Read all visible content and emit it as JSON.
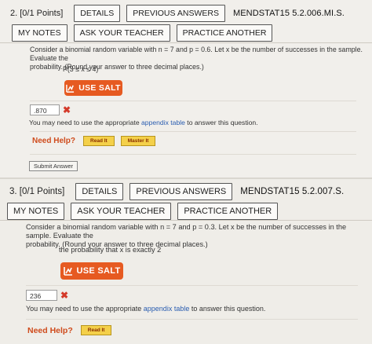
{
  "questions": [
    {
      "number_label": "2. [0/1 Points]",
      "details_label": "DETAILS",
      "previous_answers_label": "PREVIOUS ANSWERS",
      "code": "MENDSTAT15 5.2.006.MI.S.",
      "my_notes_label": "MY NOTES",
      "ask_teacher_label": "ASK YOUR TEACHER",
      "practice_label": "PRACTICE ANOTHER",
      "prompt_line1": "Consider a binomial random variable with n = 7 and p = 0.6. Let x be the number of successes in the sample. Evaluate the",
      "prompt_line2": "probability. (Round your answer to three decimal places.)",
      "probability_text": "P(3 ≤ x ≤ 4)",
      "salt_label": "USE SALT",
      "answer_value": ".870",
      "appendix_prefix": "You may need to use the appropriate ",
      "appendix_link": "appendix table",
      "appendix_suffix": " to answer this question.",
      "need_help_label": "Need Help?",
      "read_it_label": "Read It",
      "master_it_label": "Master It",
      "submit_label": "Submit Answer"
    },
    {
      "number_label": "3. [0/1 Points]",
      "details_label": "DETAILS",
      "previous_answers_label": "PREVIOUS ANSWERS",
      "code": "MENDSTAT15 5.2.007.S.",
      "my_notes_label": "MY NOTES",
      "ask_teacher_label": "ASK YOUR TEACHER",
      "practice_label": "PRACTICE ANOTHER",
      "prompt_line1": "Consider a binomial random variable with n = 7 and p = 0.3. Let x be the number of successes in the sample. Evaluate the",
      "prompt_line2": "probability. (Round your answer to three decimal places.)",
      "probability_text": "the probability that x is exactly 2",
      "salt_label": "USE SALT",
      "answer_value": "236",
      "appendix_prefix": "You may need to use the appropriate ",
      "appendix_link": "appendix table",
      "appendix_suffix": " to answer this question.",
      "need_help_label": "Need Help?",
      "read_it_label": "Read It"
    }
  ],
  "colors": {
    "salt": "#e65a21",
    "need_help": "#cf4b1c",
    "incorrect": "#d43a2a",
    "link": "#2a5db0",
    "help_button": "#f4d04a"
  },
  "icons": {
    "salt": "salt-calculator-icon",
    "incorrect": "x-mark-icon"
  }
}
